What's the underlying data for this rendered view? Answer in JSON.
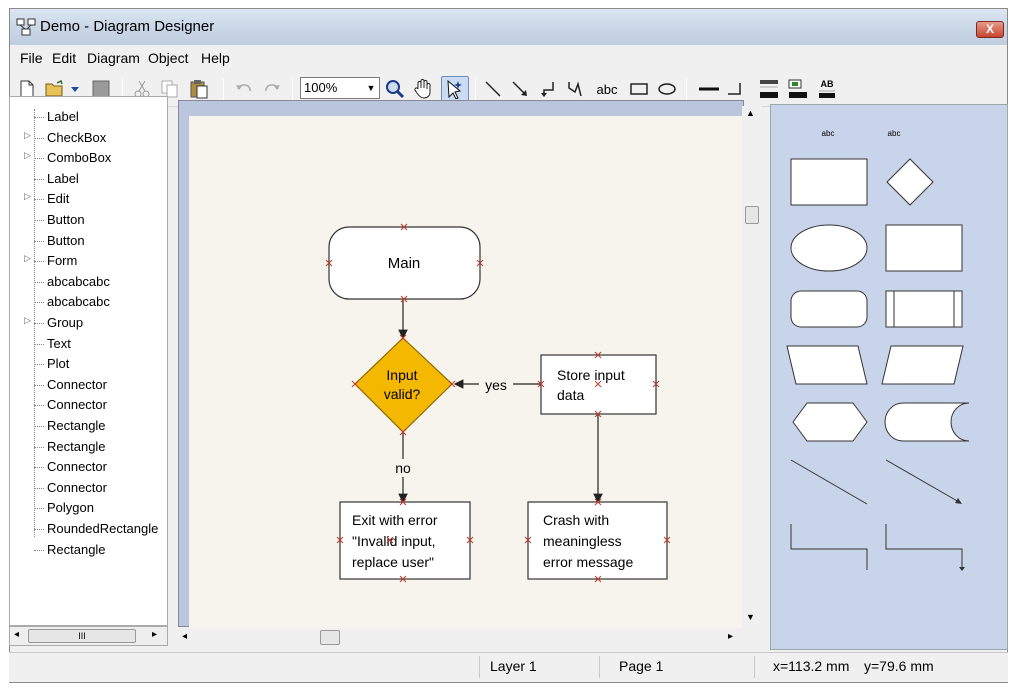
{
  "window": {
    "title": "Demo - Diagram Designer",
    "close_label": "X"
  },
  "menu": {
    "items": [
      "File",
      "Edit",
      "Diagram",
      "Object",
      "Help"
    ]
  },
  "toolbar": {
    "zoom_value": "100%",
    "abc_label": "abc",
    "ab_label": "AB"
  },
  "tree": {
    "items": [
      {
        "label": "Label",
        "expandable": false
      },
      {
        "label": "CheckBox",
        "expandable": true
      },
      {
        "label": "ComboBox",
        "expandable": true
      },
      {
        "label": "Label",
        "expandable": false
      },
      {
        "label": "Edit",
        "expandable": true
      },
      {
        "label": "Button",
        "expandable": false
      },
      {
        "label": "Button",
        "expandable": false
      },
      {
        "label": "Form",
        "expandable": true
      },
      {
        "label": "abcabcabc",
        "expandable": false
      },
      {
        "label": "abcabcabc",
        "expandable": false
      },
      {
        "label": "Group",
        "expandable": true
      },
      {
        "label": "Text",
        "expandable": false
      },
      {
        "label": "Plot",
        "expandable": false
      },
      {
        "label": "Connector",
        "expandable": false
      },
      {
        "label": "Connector",
        "expandable": false
      },
      {
        "label": "Rectangle",
        "expandable": false
      },
      {
        "label": "Rectangle",
        "expandable": false
      },
      {
        "label": "Connector",
        "expandable": false
      },
      {
        "label": "Connector",
        "expandable": false
      },
      {
        "label": "Polygon",
        "expandable": false
      },
      {
        "label": "RoundedRectangle",
        "expandable": false
      },
      {
        "label": "Rectangle",
        "expandable": false
      }
    ],
    "scroll_grip": "III"
  },
  "diagram": {
    "main": "Main",
    "decision_line1": "Input",
    "decision_line2": "valid?",
    "yes_label": "yes",
    "no_label": "no",
    "store_line1": "Store input",
    "store_line2": "data",
    "exit_line1": "Exit with error",
    "exit_line2": "\"Invalid input,",
    "exit_line3": "replace user\"",
    "crash_line1": "Crash with",
    "crash_line2": "meaningless",
    "crash_line3": "error message",
    "decision_color": "#f5b800",
    "handle_color": "#c0392b"
  },
  "palette": {
    "abc_left": "abc",
    "abc_right": "abc"
  },
  "status": {
    "layer": "Layer 1",
    "page": "Page 1",
    "x": "x=113.2 mm",
    "y": "y=79.6 mm"
  }
}
